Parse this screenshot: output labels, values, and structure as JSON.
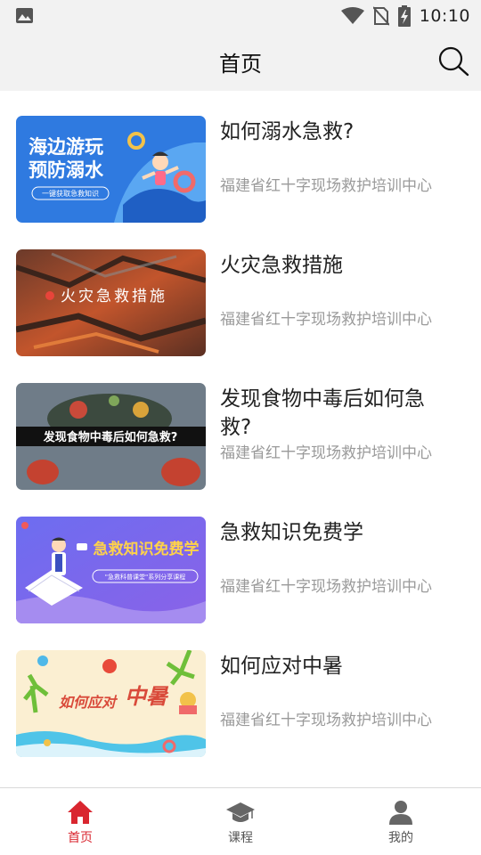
{
  "status_bar": {
    "time": "10:10",
    "icons": [
      "image-icon",
      "wifi-icon",
      "no-sim-icon",
      "battery-charging-icon"
    ]
  },
  "header": {
    "title": "首页",
    "search_icon": "search-icon"
  },
  "articles": [
    {
      "title": "如何溺水急救?",
      "source": "福建省红十字现场救护培训中心",
      "thumb_text": [
        "海边游玩",
        "预防溺水",
        "一键获取急救知识"
      ]
    },
    {
      "title": "火灾急救措施",
      "source": "福建省红十字现场救护培训中心",
      "thumb_text": [
        "火灾急救措施"
      ]
    },
    {
      "title": "发现食物中毒后如何急救?",
      "source": "福建省红十字现场救护培训中心",
      "thumb_text": [
        "发现食物中毒后如何急救?"
      ]
    },
    {
      "title": "急救知识免费学",
      "source": "福建省红十字现场救护培训中心",
      "thumb_text": [
        "急救知识免费学",
        "\"急救科普课堂\"系列分享课程"
      ]
    },
    {
      "title": "如何应对中暑",
      "source": "福建省红十字现场救护培训中心",
      "thumb_text": [
        "如何应对",
        "中暑"
      ]
    }
  ],
  "tabs": [
    {
      "label": "首页",
      "icon": "home-icon",
      "active": true
    },
    {
      "label": "课程",
      "icon": "graduation-cap-icon",
      "active": false
    },
    {
      "label": "我的",
      "icon": "user-icon",
      "active": false
    }
  ],
  "colors": {
    "accent": "#d9262f",
    "inactive": "#555555",
    "subtext": "#9a9a9a"
  }
}
